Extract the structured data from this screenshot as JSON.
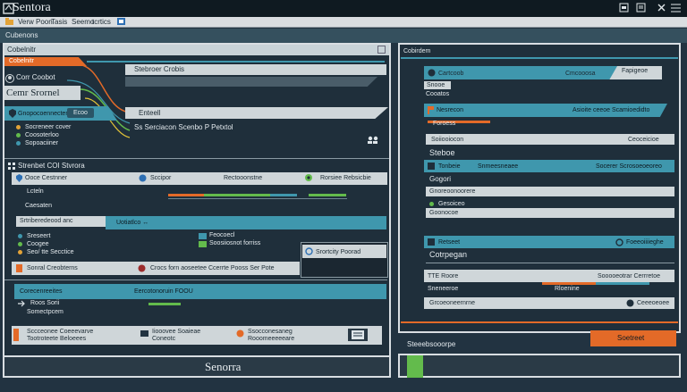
{
  "window": {
    "title": "Sentora",
    "controls": [
      "min",
      "max",
      "close"
    ]
  },
  "menu": {
    "items": [
      "Verw Poon",
      "Tasis",
      "Seemo",
      "tcrtics"
    ]
  },
  "left_panel": {
    "header": "Cubenons",
    "tab_label": "Cobelnitr",
    "breadcrumb": "Stebroer Crobis",
    "section_title": "Cemr Srornel",
    "profile_name": "Corr Coobot",
    "selected_row": "Gnopocoennecten",
    "selected_badge": "Ecoo",
    "row_rtext": "Enteell",
    "list_items": [
      "Socreneer cover",
      "Coosoterloo",
      "Sopoaciiner"
    ],
    "right_note": "Ss Serciacon Scenbo P Petxtol",
    "section2_title": "Strenbet COI Stvrora",
    "r2_col1": "Ooce Cestnner",
    "r2_col2": "Sccipor",
    "r2_col3": "Rectooonstne",
    "r2_col4": "Rorsiee Rebsicbie",
    "small_rows": [
      "Lcteln",
      "Caesaten"
    ],
    "group_label": "Srtriberedeood anc",
    "group_tag": "Uotiatlco ↔",
    "sub_list": [
      "Sreseert",
      "Coogee",
      "Seo/ tte Secctice"
    ],
    "sub_list2": [
      "Feocoecl",
      "Soosiiosnot forriss"
    ],
    "popup_label": "Srortcity Poorad",
    "action_row": [
      "Sonral Creobterns",
      "Crocs forn aoseetee Ccerrte Pooss Ser Pote"
    ],
    "blue_row_left": "Corecenreeites",
    "blue_row_right": "Eercotonoruin FOOU",
    "misc_row": [
      "Roos Sorii",
      "Somectpcem"
    ],
    "bottom_row": [
      "Sccceonee Coeeevarve",
      "Tootroteete Beloeees",
      "Iiooovee Soaieae",
      "Coneotc",
      "Ssocconesaneg",
      "Rooomeeeeeare"
    ],
    "footer_label": "Senorra"
  },
  "right_panel": {
    "header": "Cobirdem",
    "row1_left": "Cartcoob",
    "row1_mid": "Cmcooosa",
    "row1_right": "Fapigeoe",
    "row1_sub": "Snooe",
    "row1_sub2": "Cooatos",
    "row2_left": "Nesrecon",
    "row2_right": "Asioite ceeoe Scamioedidto",
    "row2_sub": "Foroess",
    "row2_sub2": "Soiiooiocon",
    "row2_note": "Ceoceicioe",
    "row3_title": "Steboe",
    "row3_left": "Tonbeie",
    "row3_mid": "Snmeesneaee",
    "row3_right": "Socerer Scrosoeoeoreo",
    "row3_sub": "Gogori",
    "row3_list": [
      "Gnoreoonoorere",
      "Gesoiceo",
      "Goonocoe"
    ],
    "row4_left": "Retseet",
    "row4_right": "Foeeoiiiieghe",
    "row4_title": "Cotrpegan",
    "row5_left": "TTE Roore",
    "row5_right": "Sooooeotrar Cerrretoe",
    "row5_sub": "Sneneeroe",
    "row5_sub_right": "Rloenine",
    "row6_left": "Grcoeoneernrne",
    "row6_right": "Ceeeoeoee",
    "orange_button": "Soetreet",
    "footer_label": "Steeebsooorpe"
  },
  "colors": {
    "accent_teal": "#3f97ad",
    "accent_orange": "#e36a28",
    "accent_green": "#63bb4c",
    "panel_bg": "#1f2f3b",
    "strip_light": "#cfd6d9"
  }
}
